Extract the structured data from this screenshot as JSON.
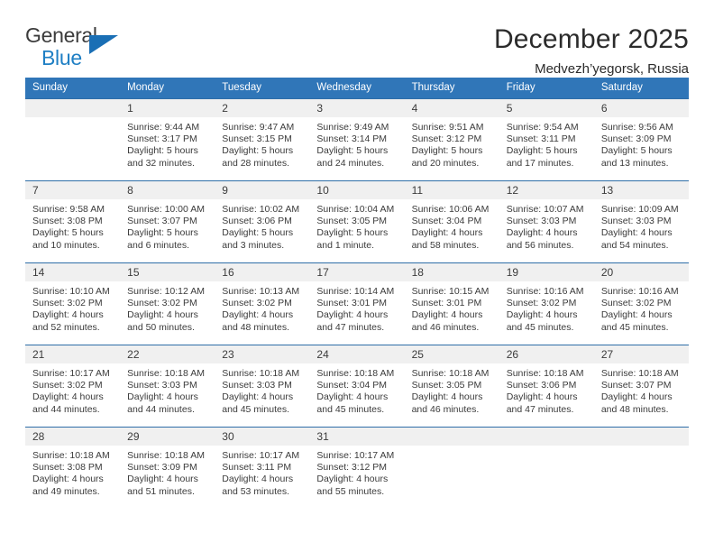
{
  "brand": {
    "name_part1": "General",
    "name_part2": "Blue"
  },
  "header": {
    "title": "December 2025",
    "subtitle": "Medvezh’yegorsk, Russia"
  },
  "colors": {
    "header_blue": "#3076b8",
    "row_border_blue": "#2f6ea8",
    "daynum_bg": "#f0f0f0",
    "logo_blue": "#1f7fc4",
    "text": "#3b3b3b"
  },
  "calendar": {
    "weekdays": [
      "Sunday",
      "Monday",
      "Tuesday",
      "Wednesday",
      "Thursday",
      "Friday",
      "Saturday"
    ],
    "weeks": [
      [
        {
          "day": "",
          "sunrise": "",
          "sunset": "",
          "daylight1": "",
          "daylight2": ""
        },
        {
          "day": "1",
          "sunrise": "Sunrise: 9:44 AM",
          "sunset": "Sunset: 3:17 PM",
          "daylight1": "Daylight: 5 hours",
          "daylight2": "and 32 minutes."
        },
        {
          "day": "2",
          "sunrise": "Sunrise: 9:47 AM",
          "sunset": "Sunset: 3:15 PM",
          "daylight1": "Daylight: 5 hours",
          "daylight2": "and 28 minutes."
        },
        {
          "day": "3",
          "sunrise": "Sunrise: 9:49 AM",
          "sunset": "Sunset: 3:14 PM",
          "daylight1": "Daylight: 5 hours",
          "daylight2": "and 24 minutes."
        },
        {
          "day": "4",
          "sunrise": "Sunrise: 9:51 AM",
          "sunset": "Sunset: 3:12 PM",
          "daylight1": "Daylight: 5 hours",
          "daylight2": "and 20 minutes."
        },
        {
          "day": "5",
          "sunrise": "Sunrise: 9:54 AM",
          "sunset": "Sunset: 3:11 PM",
          "daylight1": "Daylight: 5 hours",
          "daylight2": "and 17 minutes."
        },
        {
          "day": "6",
          "sunrise": "Sunrise: 9:56 AM",
          "sunset": "Sunset: 3:09 PM",
          "daylight1": "Daylight: 5 hours",
          "daylight2": "and 13 minutes."
        }
      ],
      [
        {
          "day": "7",
          "sunrise": "Sunrise: 9:58 AM",
          "sunset": "Sunset: 3:08 PM",
          "daylight1": "Daylight: 5 hours",
          "daylight2": "and 10 minutes."
        },
        {
          "day": "8",
          "sunrise": "Sunrise: 10:00 AM",
          "sunset": "Sunset: 3:07 PM",
          "daylight1": "Daylight: 5 hours",
          "daylight2": "and 6 minutes."
        },
        {
          "day": "9",
          "sunrise": "Sunrise: 10:02 AM",
          "sunset": "Sunset: 3:06 PM",
          "daylight1": "Daylight: 5 hours",
          "daylight2": "and 3 minutes."
        },
        {
          "day": "10",
          "sunrise": "Sunrise: 10:04 AM",
          "sunset": "Sunset: 3:05 PM",
          "daylight1": "Daylight: 5 hours",
          "daylight2": "and 1 minute."
        },
        {
          "day": "11",
          "sunrise": "Sunrise: 10:06 AM",
          "sunset": "Sunset: 3:04 PM",
          "daylight1": "Daylight: 4 hours",
          "daylight2": "and 58 minutes."
        },
        {
          "day": "12",
          "sunrise": "Sunrise: 10:07 AM",
          "sunset": "Sunset: 3:03 PM",
          "daylight1": "Daylight: 4 hours",
          "daylight2": "and 56 minutes."
        },
        {
          "day": "13",
          "sunrise": "Sunrise: 10:09 AM",
          "sunset": "Sunset: 3:03 PM",
          "daylight1": "Daylight: 4 hours",
          "daylight2": "and 54 minutes."
        }
      ],
      [
        {
          "day": "14",
          "sunrise": "Sunrise: 10:10 AM",
          "sunset": "Sunset: 3:02 PM",
          "daylight1": "Daylight: 4 hours",
          "daylight2": "and 52 minutes."
        },
        {
          "day": "15",
          "sunrise": "Sunrise: 10:12 AM",
          "sunset": "Sunset: 3:02 PM",
          "daylight1": "Daylight: 4 hours",
          "daylight2": "and 50 minutes."
        },
        {
          "day": "16",
          "sunrise": "Sunrise: 10:13 AM",
          "sunset": "Sunset: 3:02 PM",
          "daylight1": "Daylight: 4 hours",
          "daylight2": "and 48 minutes."
        },
        {
          "day": "17",
          "sunrise": "Sunrise: 10:14 AM",
          "sunset": "Sunset: 3:01 PM",
          "daylight1": "Daylight: 4 hours",
          "daylight2": "and 47 minutes."
        },
        {
          "day": "18",
          "sunrise": "Sunrise: 10:15 AM",
          "sunset": "Sunset: 3:01 PM",
          "daylight1": "Daylight: 4 hours",
          "daylight2": "and 46 minutes."
        },
        {
          "day": "19",
          "sunrise": "Sunrise: 10:16 AM",
          "sunset": "Sunset: 3:02 PM",
          "daylight1": "Daylight: 4 hours",
          "daylight2": "and 45 minutes."
        },
        {
          "day": "20",
          "sunrise": "Sunrise: 10:16 AM",
          "sunset": "Sunset: 3:02 PM",
          "daylight1": "Daylight: 4 hours",
          "daylight2": "and 45 minutes."
        }
      ],
      [
        {
          "day": "21",
          "sunrise": "Sunrise: 10:17 AM",
          "sunset": "Sunset: 3:02 PM",
          "daylight1": "Daylight: 4 hours",
          "daylight2": "and 44 minutes."
        },
        {
          "day": "22",
          "sunrise": "Sunrise: 10:18 AM",
          "sunset": "Sunset: 3:03 PM",
          "daylight1": "Daylight: 4 hours",
          "daylight2": "and 44 minutes."
        },
        {
          "day": "23",
          "sunrise": "Sunrise: 10:18 AM",
          "sunset": "Sunset: 3:03 PM",
          "daylight1": "Daylight: 4 hours",
          "daylight2": "and 45 minutes."
        },
        {
          "day": "24",
          "sunrise": "Sunrise: 10:18 AM",
          "sunset": "Sunset: 3:04 PM",
          "daylight1": "Daylight: 4 hours",
          "daylight2": "and 45 minutes."
        },
        {
          "day": "25",
          "sunrise": "Sunrise: 10:18 AM",
          "sunset": "Sunset: 3:05 PM",
          "daylight1": "Daylight: 4 hours",
          "daylight2": "and 46 minutes."
        },
        {
          "day": "26",
          "sunrise": "Sunrise: 10:18 AM",
          "sunset": "Sunset: 3:06 PM",
          "daylight1": "Daylight: 4 hours",
          "daylight2": "and 47 minutes."
        },
        {
          "day": "27",
          "sunrise": "Sunrise: 10:18 AM",
          "sunset": "Sunset: 3:07 PM",
          "daylight1": "Daylight: 4 hours",
          "daylight2": "and 48 minutes."
        }
      ],
      [
        {
          "day": "28",
          "sunrise": "Sunrise: 10:18 AM",
          "sunset": "Sunset: 3:08 PM",
          "daylight1": "Daylight: 4 hours",
          "daylight2": "and 49 minutes."
        },
        {
          "day": "29",
          "sunrise": "Sunrise: 10:18 AM",
          "sunset": "Sunset: 3:09 PM",
          "daylight1": "Daylight: 4 hours",
          "daylight2": "and 51 minutes."
        },
        {
          "day": "30",
          "sunrise": "Sunrise: 10:17 AM",
          "sunset": "Sunset: 3:11 PM",
          "daylight1": "Daylight: 4 hours",
          "daylight2": "and 53 minutes."
        },
        {
          "day": "31",
          "sunrise": "Sunrise: 10:17 AM",
          "sunset": "Sunset: 3:12 PM",
          "daylight1": "Daylight: 4 hours",
          "daylight2": "and 55 minutes."
        },
        {
          "day": "",
          "sunrise": "",
          "sunset": "",
          "daylight1": "",
          "daylight2": ""
        },
        {
          "day": "",
          "sunrise": "",
          "sunset": "",
          "daylight1": "",
          "daylight2": ""
        },
        {
          "day": "",
          "sunrise": "",
          "sunset": "",
          "daylight1": "",
          "daylight2": ""
        }
      ]
    ]
  }
}
